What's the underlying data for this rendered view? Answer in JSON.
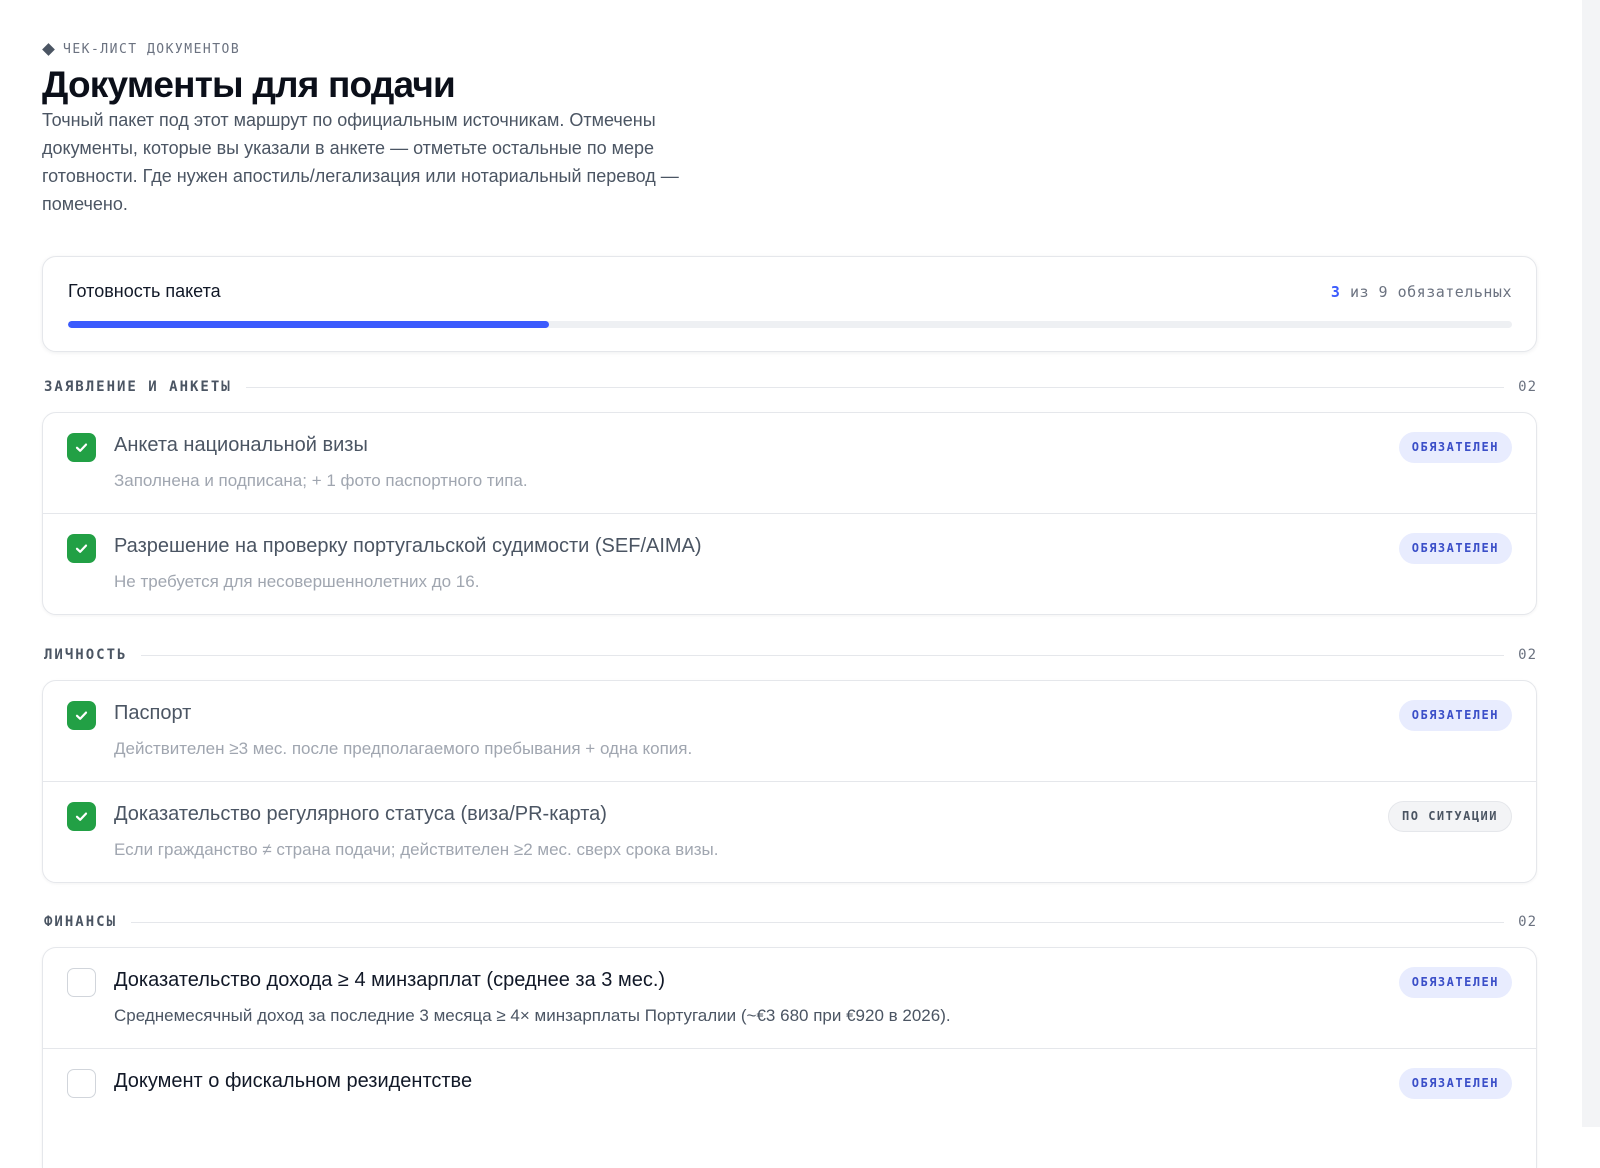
{
  "header": {
    "eyebrow": "ЧЕК-ЛИСТ ДОКУМЕНТОВ",
    "title": "Документы для подачи",
    "intro": "Точный пакет под этот маршрут по официальным источникам. Отмечены документы, которые вы указали в анкете — отметьте остальные по мере готовности. Где нужен апостиль/легализация или нотариальный перевод — помечено."
  },
  "progress": {
    "label": "Готовность пакета",
    "done": "3",
    "rest": "из 9 обязательных",
    "fraction": 0.333,
    "accent_color": "#3b5bfd"
  },
  "sections": [
    {
      "title": "ЗАЯВЛЕНИЕ И АНКЕТЫ",
      "count": "02",
      "items": [
        {
          "checked": true,
          "name": "Анкета национальной визы",
          "desc": "Заполнена и подписана; + 1 фото паспортного типа.",
          "badge": "ОБЯЗАТЕЛЕН",
          "badge_type": "required"
        },
        {
          "checked": true,
          "name": "Разрешение на проверку португальской судимости (SEF/AIMA)",
          "desc": "Не требуется для несовершеннолетних до 16.",
          "badge": "ОБЯЗАТЕЛЕН",
          "badge_type": "required"
        }
      ]
    },
    {
      "title": "ЛИЧНОСТЬ",
      "count": "02",
      "items": [
        {
          "checked": true,
          "name": "Паспорт",
          "desc": "Действителен ≥3 мес. после предполагаемого пребывания + одна копия.",
          "badge": "ОБЯЗАТЕЛЕН",
          "badge_type": "required"
        },
        {
          "checked": true,
          "name": "Доказательство регулярного статуса (виза/PR-карта)",
          "desc": "Если гражданство ≠ страна подачи; действителен ≥2 мес. сверх срока визы.",
          "badge": "ПО СИТУАЦИИ",
          "badge_type": "situational"
        }
      ]
    },
    {
      "title": "ФИНАНСЫ",
      "count": "02",
      "items": [
        {
          "checked": false,
          "name": "Доказательство дохода ≥ 4 минзарплат (среднее за 3 мес.)",
          "desc": "Среднемесячный доход за последние 3 месяца ≥ 4× минзарплаты Португалии (~€3 680 при €920 в 2026).",
          "badge": "ОБЯЗАТЕЛЕН",
          "badge_type": "required"
        },
        {
          "checked": false,
          "name": "Документ о фискальном резидентстве",
          "desc": "",
          "badge": "ОБЯЗАТЕЛЕН",
          "badge_type": "required"
        }
      ]
    }
  ],
  "colors": {
    "check_green": "#22a045",
    "badge_required_bg": "#e8ecfe",
    "badge_required_fg": "#3b4fc8"
  }
}
